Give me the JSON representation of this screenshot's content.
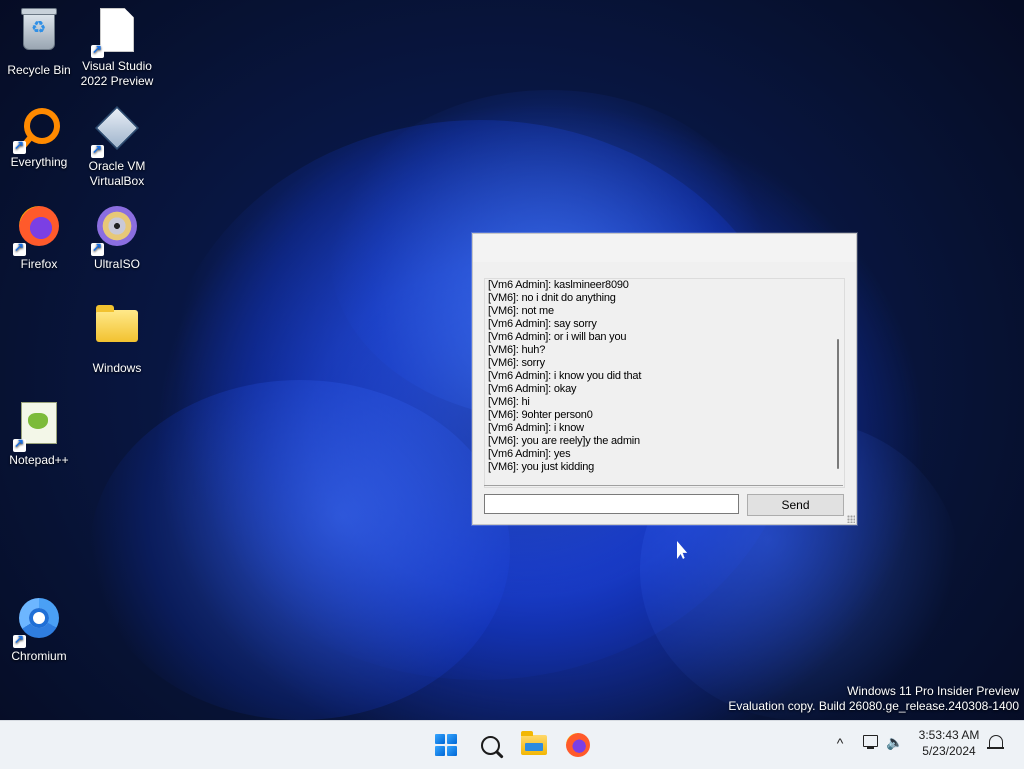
{
  "desktop": {
    "icons": [
      {
        "label": "Recycle Bin",
        "icon": "recycle-bin-icon"
      },
      {
        "label": "Visual Studio 2022 Preview",
        "icon": "visual-studio-icon"
      },
      {
        "label": "Everything",
        "icon": "everything-search-icon"
      },
      {
        "label": "Oracle VM VirtualBox",
        "icon": "virtualbox-icon"
      },
      {
        "label": "Firefox",
        "icon": "firefox-icon"
      },
      {
        "label": "UltraISO",
        "icon": "ultraiso-disc-icon"
      },
      {
        "label": "Windows",
        "icon": "folder-icon"
      },
      {
        "label": "Notepad++",
        "icon": "notepad-plus-plus-icon"
      },
      {
        "label": "Chromium",
        "icon": "chromium-icon"
      }
    ]
  },
  "chat": {
    "messages": [
      "[Vm6 Admin]: kaslmineer8090",
      "[VM6]: no i dnit do anything",
      "[VM6]: not me",
      "[Vm6 Admin]: say sorry",
      "[Vm6 Admin]: or i will ban you",
      "[VM6]: huh?",
      "[VM6]: sorry",
      "[Vm6 Admin]: i know you did that",
      "[Vm6 Admin]: okay",
      "[VM6]: hi",
      "[VM6]: 9ohter person0",
      "[Vm6 Admin]: i know",
      "[VM6]: you are reely]y the admin",
      "[Vm6 Admin]: yes",
      "[VM6]: you just kidding"
    ],
    "input_value": "",
    "send_label": "Send"
  },
  "watermark": {
    "line1": "Windows 11 Pro Insider Preview",
    "line2": "Evaluation copy. Build 26080.ge_release.240308-1400"
  },
  "taskbar": {
    "apps": [
      "start-icon",
      "search-icon",
      "file-explorer-icon",
      "firefox-icon"
    ],
    "tray": {
      "chevron": "^",
      "time": "3:53:43 AM",
      "date": "5/23/2024"
    }
  },
  "colors": {
    "taskbar_bg": "#eef2f6",
    "window_bg": "#f0f0f0",
    "accent": "#0067d6"
  }
}
